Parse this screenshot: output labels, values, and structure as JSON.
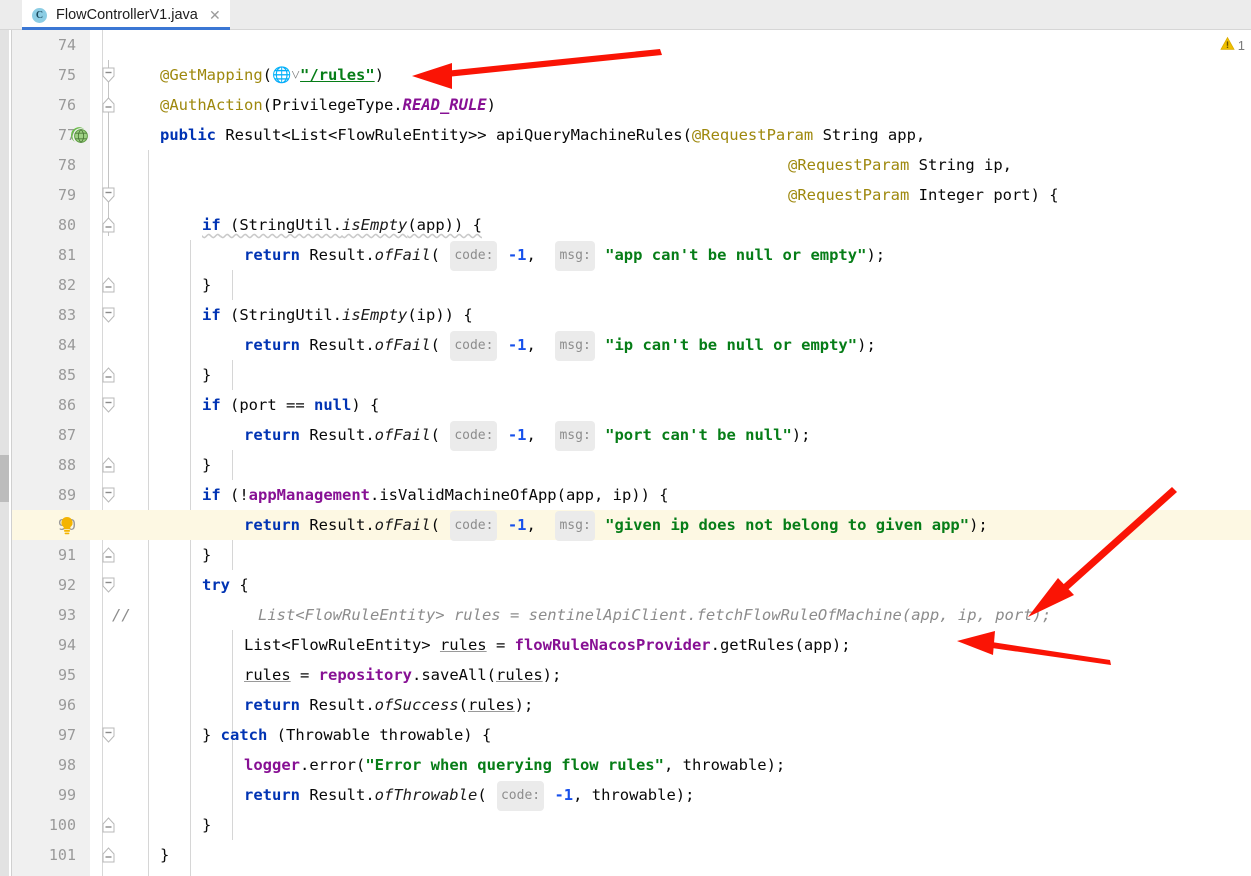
{
  "window": {
    "tab": {
      "label": "FlowControllerV1.java",
      "icon": "java-class-icon",
      "icon_letter": "C",
      "close_icon": "close-icon",
      "accent_color": "#3b77d4"
    }
  },
  "inspection": {
    "warning_icon": "warning-triangle-icon",
    "warning_count": "1",
    "warning_color": "#edc000"
  },
  "editor": {
    "first_line": 74,
    "highlighted_line": 90,
    "gutter_icons": {
      "line_77": "spring-web-mapping-icon",
      "line_90": "intention-bulb-icon",
      "line_93": "comment-marker"
    },
    "lines": [
      {
        "n": "74",
        "text": ""
      },
      {
        "n": "75",
        "text": "    @GetMapping(\"/rules\")"
      },
      {
        "n": "76",
        "text": "    @AuthAction(PrivilegeType.READ_RULE)"
      },
      {
        "n": "77",
        "text": "    public Result<List<FlowRuleEntity>> apiQueryMachineRules(@RequestParam String app,"
      },
      {
        "n": "78",
        "text": "                                                            @RequestParam String ip,"
      },
      {
        "n": "79",
        "text": "                                                            @RequestParam Integer port) {"
      },
      {
        "n": "80",
        "text": "        if (StringUtil.isEmpty(app)) {"
      },
      {
        "n": "81",
        "text": "            return Result.ofFail( code: -1,  msg: \"app can't be null or empty\");"
      },
      {
        "n": "82",
        "text": "        }"
      },
      {
        "n": "83",
        "text": "        if (StringUtil.isEmpty(ip)) {"
      },
      {
        "n": "84",
        "text": "            return Result.ofFail( code: -1,  msg: \"ip can't be null or empty\");"
      },
      {
        "n": "85",
        "text": "        }"
      },
      {
        "n": "86",
        "text": "        if (port == null) {"
      },
      {
        "n": "87",
        "text": "            return Result.ofFail( code: -1,  msg: \"port can't be null\");"
      },
      {
        "n": "88",
        "text": "        }"
      },
      {
        "n": "89",
        "text": "        if (!appManagement.isValidMachineOfApp(app, ip)) {"
      },
      {
        "n": "90",
        "text": "            return Result.ofFail( code: -1,  msg: \"given ip does not belong to given app\");"
      },
      {
        "n": "91",
        "text": "        }"
      },
      {
        "n": "92",
        "text": "        try {"
      },
      {
        "n": "93",
        "text": "            List<FlowRuleEntity> rules = sentinelApiClient.fetchFlowRuleOfMachine(app, ip, port);"
      },
      {
        "n": "94",
        "text": "            List<FlowRuleEntity> rules = flowRuleNacosProvider.getRules(app);"
      },
      {
        "n": "95",
        "text": "            rules = repository.saveAll(rules);"
      },
      {
        "n": "96",
        "text": "            return Result.ofSuccess(rules);"
      },
      {
        "n": "97",
        "text": "        } catch (Throwable throwable) {"
      },
      {
        "n": "98",
        "text": "            logger.error(\"Error when querying flow rules\", throwable);"
      },
      {
        "n": "99",
        "text": "            return Result.ofThrowable( code: -1, throwable);"
      },
      {
        "n": "100",
        "text": "        }"
      },
      {
        "n": "101",
        "text": "    }"
      }
    ],
    "inlay_hints": [
      "code:",
      "msg:"
    ],
    "string_literals": [
      "\"/rules\"",
      "\"app can't be null or empty\"",
      "\"ip can't be null or empty\"",
      "\"port can't be null\"",
      "\"given ip does not belong to given app\"",
      "\"Error when querying flow rules\""
    ],
    "comment_slash": "//"
  },
  "annotations": {
    "arrows": [
      {
        "name": "arrow-to-get-mapping-path",
        "color": "#fa1405"
      },
      {
        "name": "arrow-to-commented-sentinel-call",
        "color": "#fa1405"
      },
      {
        "name": "arrow-to-nacos-provider-call",
        "color": "#fa1405"
      }
    ]
  }
}
